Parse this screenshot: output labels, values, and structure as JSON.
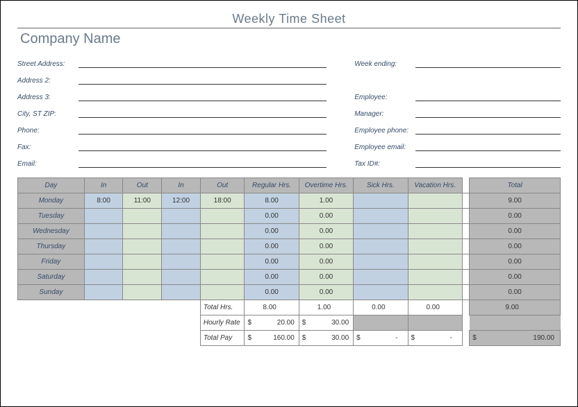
{
  "title": "Weekly Time Sheet",
  "company": "Company Name",
  "left_labels": [
    "Street Address:",
    "Address 2:",
    "Address 3:",
    "City, ST  ZIP:",
    "Phone:",
    "Fax:",
    "Email:"
  ],
  "right_labels": [
    "Week ending:",
    "",
    "Employee:",
    "Manager:",
    "Employee phone:",
    "Employee email:",
    "Tax ID#:"
  ],
  "table": {
    "headers": [
      "Day",
      "In",
      "Out",
      "In",
      "Out",
      "Regular Hrs.",
      "Overtime Hrs.",
      "Sick Hrs.",
      "Vacation Hrs.",
      "Total"
    ],
    "rows": [
      {
        "day": "Monday",
        "in1": "8:00",
        "out1": "11:00",
        "in2": "12:00",
        "out2": "18:00",
        "reg": "8.00",
        "ot": "1.00",
        "sick": "",
        "vac": "",
        "total": "9.00"
      },
      {
        "day": "Tuesday",
        "in1": "",
        "out1": "",
        "in2": "",
        "out2": "",
        "reg": "0.00",
        "ot": "0.00",
        "sick": "",
        "vac": "",
        "total": "0.00"
      },
      {
        "day": "Wednesday",
        "in1": "",
        "out1": "",
        "in2": "",
        "out2": "",
        "reg": "0.00",
        "ot": "0.00",
        "sick": "",
        "vac": "",
        "total": "0.00"
      },
      {
        "day": "Thursday",
        "in1": "",
        "out1": "",
        "in2": "",
        "out2": "",
        "reg": "0.00",
        "ot": "0.00",
        "sick": "",
        "vac": "",
        "total": "0.00"
      },
      {
        "day": "Friday",
        "in1": "",
        "out1": "",
        "in2": "",
        "out2": "",
        "reg": "0.00",
        "ot": "0.00",
        "sick": "",
        "vac": "",
        "total": "0.00"
      },
      {
        "day": "Saturday",
        "in1": "",
        "out1": "",
        "in2": "",
        "out2": "",
        "reg": "0.00",
        "ot": "0.00",
        "sick": "",
        "vac": "",
        "total": "0.00"
      },
      {
        "day": "Sunday",
        "in1": "",
        "out1": "",
        "in2": "",
        "out2": "",
        "reg": "0.00",
        "ot": "0.00",
        "sick": "",
        "vac": "",
        "total": "0.00"
      }
    ],
    "summary": {
      "total_hrs_label": "Total Hrs.",
      "hourly_rate_label": "Hourly Rate",
      "total_pay_label": "Total Pay",
      "currency": "$",
      "dash": "-",
      "total_hrs": {
        "reg": "8.00",
        "ot": "1.00",
        "sick": "0.00",
        "vac": "0.00",
        "total": "9.00"
      },
      "hourly_rate": {
        "reg": "20.00",
        "ot": "30.00"
      },
      "total_pay": {
        "reg": "160.00",
        "ot": "30.00",
        "total": "190.00"
      }
    }
  }
}
